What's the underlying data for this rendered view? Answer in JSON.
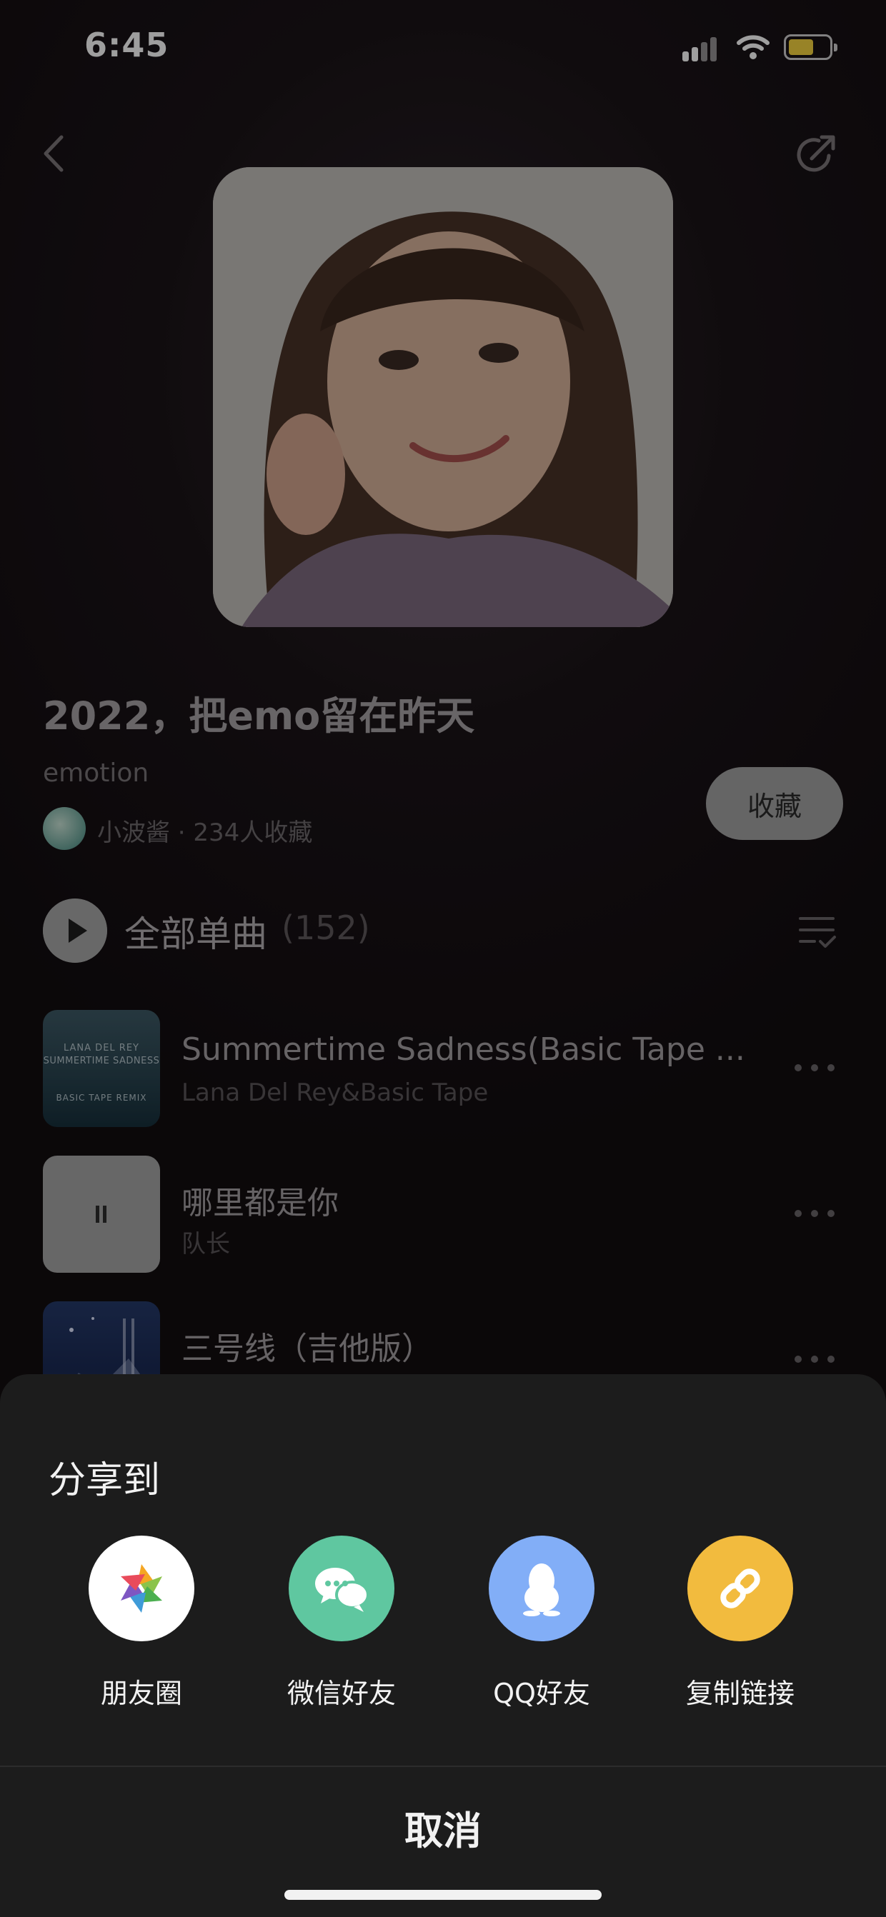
{
  "status_bar": {
    "time": "6:45"
  },
  "header": {
    "back_icon": "chevron-left-icon",
    "share_icon": "share-arrow-icon"
  },
  "playlist": {
    "title": "2022，把emo留在昨天",
    "tag": "emotion",
    "creator_line": "小波酱 · 234人收藏",
    "collect_label": "收藏"
  },
  "song_list": {
    "play_all_label": "全部单曲",
    "count": "(152)",
    "songs": [
      {
        "title": "Summertime Sadness(Basic Tape ...",
        "artist": "Lana Del Rey&Basic Tape",
        "cover_text": [
          "LANA DEL REY",
          "SUMMERTIME SADNESS",
          "BASIC TAPE REMIX"
        ]
      },
      {
        "title": "哪里都是你",
        "artist": "队长"
      },
      {
        "title": "三号线（吉他版）",
        "artist": ""
      }
    ]
  },
  "share_sheet": {
    "title": "分享到",
    "targets": [
      {
        "label": "朋友圈",
        "icon": "moments-aperture-icon",
        "color": "#ffffff"
      },
      {
        "label": "微信好友",
        "icon": "wechat-icon",
        "color": "#5fc7a0"
      },
      {
        "label": "QQ好友",
        "icon": "qq-penguin-icon",
        "color": "#82aef7"
      },
      {
        "label": "复制链接",
        "icon": "link-icon",
        "color": "#f2bb3e"
      }
    ],
    "cancel_label": "取消"
  }
}
